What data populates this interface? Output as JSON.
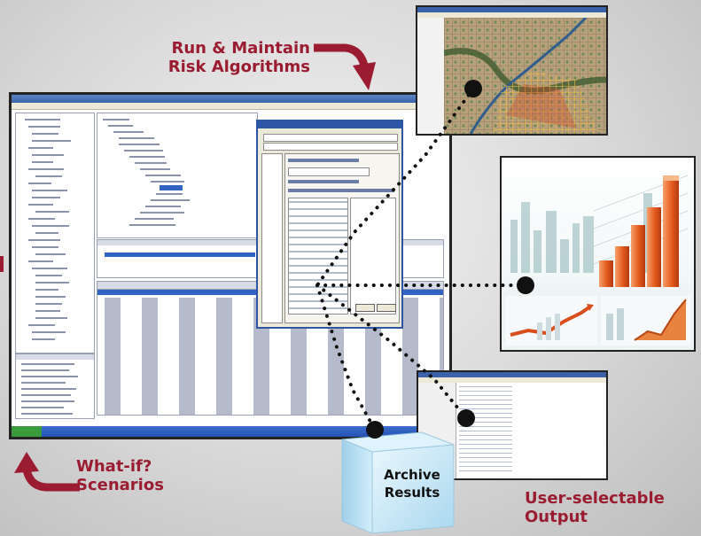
{
  "labels": {
    "run_maintain": "Run & Maintain\nRisk Algorithms",
    "what_if": "What-if?\nScenarios",
    "user_selectable": "User-selectable\nOutput"
  },
  "archive": {
    "line1": "Archive",
    "line2": "Results"
  },
  "colors": {
    "accent": "#9b1b30",
    "dots": "#111111",
    "window_border": "#222222",
    "dialog_frame": "#2c55a5",
    "taskbar": "#2452b3",
    "cube": "#bfe3f5"
  },
  "icons": {
    "arrow_top": "curved-arrow-down-icon",
    "arrow_bottom": "curved-arrow-up-icon"
  }
}
